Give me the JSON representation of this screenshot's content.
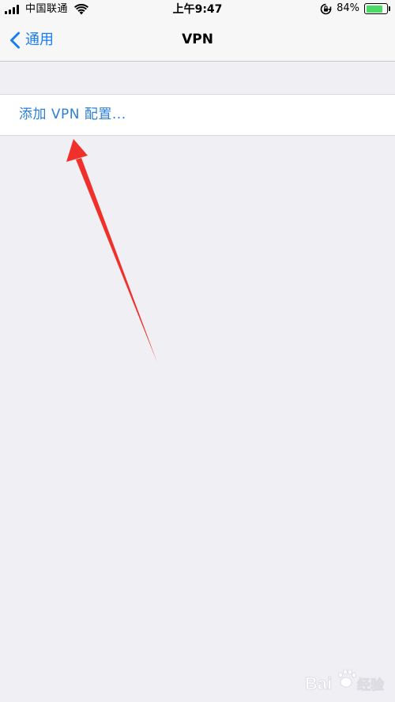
{
  "status_bar": {
    "carrier": "中国联通",
    "time": "上午9:47",
    "battery_percent": "84%",
    "battery_level": 0.84,
    "battery_color": "#4cd964",
    "icons": [
      "signal-bars-icon",
      "wifi-icon",
      "rotation-lock-icon",
      "battery-icon"
    ]
  },
  "nav": {
    "back_label": "通用",
    "title": "VPN",
    "accent_color": "#1a7cf4"
  },
  "content": {
    "add_vpn_label": "添加 VPN 配置...",
    "link_color": "#2c7fd6"
  },
  "annotation": {
    "type": "arrow",
    "color": "#f0302a"
  }
}
